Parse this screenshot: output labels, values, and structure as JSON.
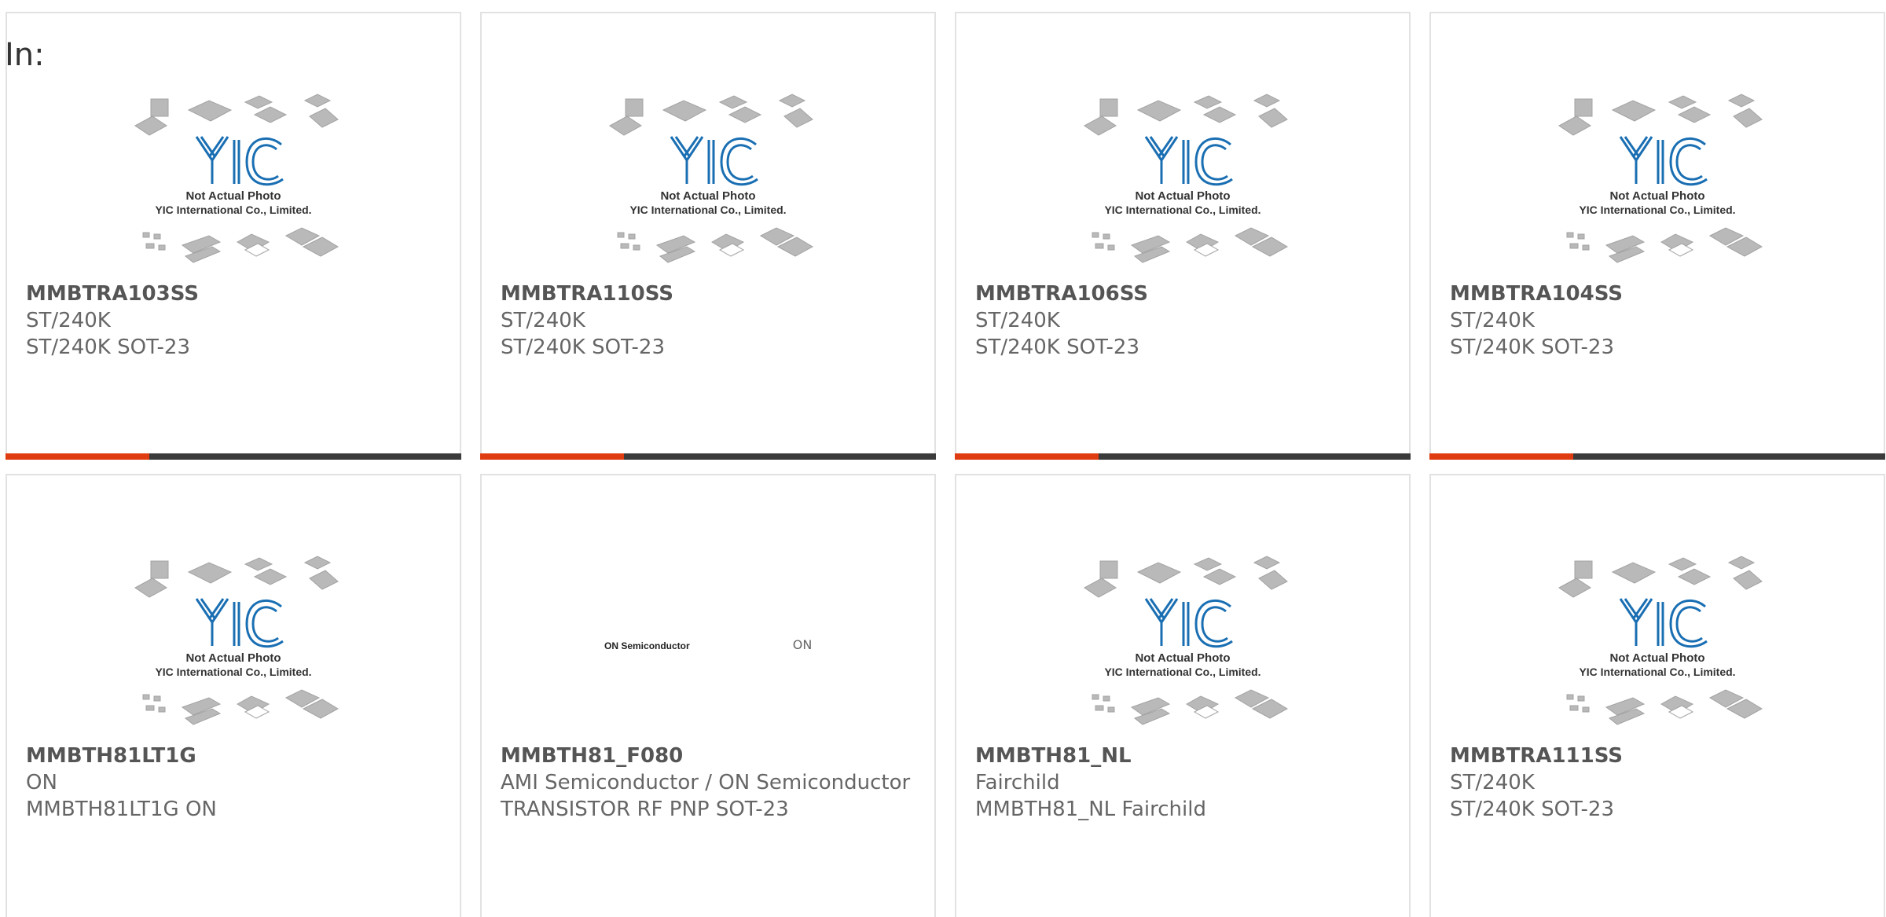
{
  "filter": {
    "label": "In:"
  },
  "colors": {
    "accent": "#e03c12",
    "bar": "#3b3b3b",
    "logo_blue": "#1a6fb3",
    "on_green": "#1f8f3a"
  },
  "placeholder": {
    "line1": "Not Actual Photo",
    "line2": "YIC International Co., Limited.",
    "logo_text": "YIC"
  },
  "on_logo": {
    "text": "ON Semiconductor",
    "badge": "ON"
  },
  "products": [
    {
      "pn": "MMBTRA103SS",
      "mfr": "ST/240K",
      "desc": "ST/240K SOT-23",
      "image": "yic-placeholder"
    },
    {
      "pn": "MMBTRA110SS",
      "mfr": "ST/240K",
      "desc": "ST/240K SOT-23",
      "image": "yic-placeholder"
    },
    {
      "pn": "MMBTRA106SS",
      "mfr": "ST/240K",
      "desc": "ST/240K SOT-23",
      "image": "yic-placeholder"
    },
    {
      "pn": "MMBTRA104SS",
      "mfr": "ST/240K",
      "desc": "ST/240K SOT-23",
      "image": "yic-placeholder"
    },
    {
      "pn": "MMBTH81LT1G",
      "mfr": "ON",
      "desc": "MMBTH81LT1G ON",
      "image": "yic-placeholder"
    },
    {
      "pn": "MMBTH81_F080",
      "mfr": "AMI Semiconductor / ON Semiconductor",
      "desc": "TRANSISTOR RF PNP SOT-23",
      "image": "on-semiconductor-logo"
    },
    {
      "pn": "MMBTH81_NL",
      "mfr": "Fairchild",
      "desc": "MMBTH81_NL Fairchild",
      "image": "yic-placeholder"
    },
    {
      "pn": "MMBTRA111SS",
      "mfr": "ST/240K",
      "desc": "ST/240K SOT-23",
      "image": "yic-placeholder"
    }
  ]
}
